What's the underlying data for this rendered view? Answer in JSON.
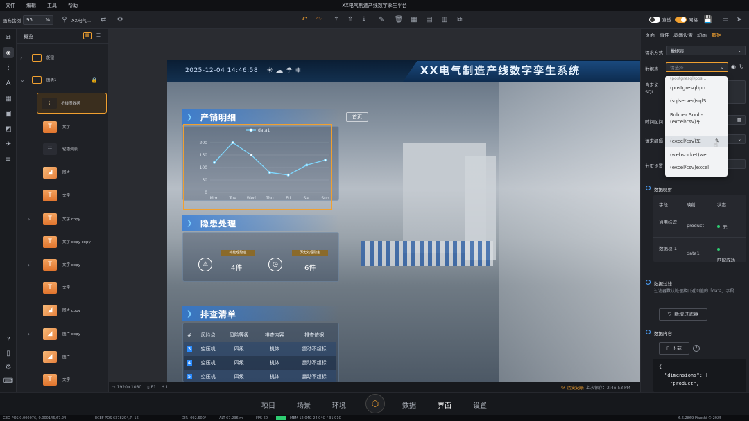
{
  "app": {
    "title": "XX电气制造产线数字孪生平台",
    "menu": [
      "文件",
      "编辑",
      "工具",
      "帮助"
    ]
  },
  "toolbar": {
    "zoom_label": "画布比例",
    "zoom_value": "95",
    "zoom_unit": "%",
    "project_name": "XX电气..."
  },
  "toolbar_right": {
    "toggle1": "穿透",
    "toggle2": "网格"
  },
  "left_panel": {
    "title": "概览",
    "items": [
      {
        "label": "旋钮",
        "type": "folder"
      },
      {
        "label": "图表1",
        "type": "folder"
      },
      {
        "label": "折线图数据",
        "type": "chart"
      },
      {
        "label": "文字",
        "type": "text"
      },
      {
        "label": "轮播列表",
        "type": "list"
      },
      {
        "label": "图片",
        "type": "image"
      },
      {
        "label": "文字",
        "type": "text"
      },
      {
        "label": "文字 copy",
        "type": "text"
      },
      {
        "label": "文字 copy copy",
        "type": "text"
      },
      {
        "label": "文字 copy",
        "type": "text"
      },
      {
        "label": "文字",
        "type": "text"
      },
      {
        "label": "图片 copy",
        "type": "image"
      },
      {
        "label": "图片 copy",
        "type": "image"
      },
      {
        "label": "图片",
        "type": "image"
      },
      {
        "label": "文字",
        "type": "text"
      }
    ]
  },
  "scene": {
    "datetime": "2025-12-04 14:46:58",
    "title": "XX电气制造产线数字孪生系统",
    "home_button": "首页",
    "section1_title": "产销明细",
    "section2_title": "隐患处理",
    "section3_title": "排查清单",
    "hazard": {
      "pending_label": "待处理隐患",
      "pending_value": "4件",
      "processed_label": "历史处理隐患",
      "processed_value": "6件"
    },
    "risk_table": {
      "headers": [
        "#",
        "风险点",
        "风险等级",
        "排查内容",
        "排查依据"
      ],
      "rows": [
        [
          "3",
          "空压机",
          "四级",
          "机体",
          "震动不超标"
        ],
        [
          "4",
          "空压机",
          "四级",
          "机体",
          "震动不超标"
        ],
        [
          "5",
          "空压机",
          "四级",
          "机体",
          "震动不超标"
        ]
      ]
    }
  },
  "chart_data": {
    "type": "line",
    "categories": [
      "Mon",
      "Tue",
      "Wed",
      "Thu",
      "Fri",
      "Sat",
      "Sun"
    ],
    "series": [
      {
        "name": "data1",
        "values": [
          120,
          200,
          150,
          80,
          70,
          110,
          130
        ]
      }
    ],
    "ylim": [
      0,
      200
    ],
    "yticks": [
      0,
      50,
      100,
      150,
      200
    ],
    "legend": "top",
    "color": "#7fd8ff"
  },
  "statusbar": {
    "resolution": "1920×1080",
    "page": "P1",
    "layer_count": "1",
    "history": "历史记录",
    "last_saved": "上次保存：2:46:53 PM"
  },
  "bottom_nav": [
    "项目",
    "场景",
    "环境",
    "数据",
    "界面",
    "设置"
  ],
  "right_panel": {
    "tabs": [
      "页面",
      "事件",
      "基础设置",
      "动画",
      "数据"
    ],
    "request_label": "请求方式",
    "request_value": "数据表",
    "datasource_label": "数据表",
    "datasource_placeholder": "请选择",
    "sql_label": "自定义\nSQL",
    "time_label": "时间区间",
    "interval_label": "请求间隔",
    "page_label": "分页设置",
    "mapping_title": "数据映射",
    "mapping_headers": [
      "字段",
      "映射",
      "状态"
    ],
    "mapping_rows": [
      {
        "field": "通用标识",
        "map": "product",
        "status": "无"
      },
      {
        "field": "数据项-1",
        "map": "data1",
        "status": "匹配成功"
      }
    ],
    "filter_title": "数据过滤",
    "filter_desc": "过滤器默认处理接口返回值的「data」字段",
    "filter_button": "新增过滤器",
    "content_title": "数据内容",
    "download_button": "下载",
    "code_lines": [
      "{",
      "\"dimensions\": [",
      "\"product\","
    ]
  },
  "dropdown_options": [
    "(postgresql)pos...",
    "(postgresql)po...",
    "(sqlserver)sqlS...",
    "Rubber Soul - (excel/csv)车",
    "(excel/csv)车",
    "(websocket)we...",
    "(excel/csv)excel"
  ],
  "footer": {
    "geo": "GEO POS 0.000076,-0.000146,67.24",
    "ecef": "ECEF POS 6378204,7,-16",
    "dir": "DIR -092.600°",
    "alt": "ALT 67.236 m",
    "fps": "FPS 60",
    "mem": "MEM 12.04G 24.04G / 31.91G",
    "version": "6.6.2869 Piaoshi © 2025"
  },
  "colors": {
    "accent": "#4da3ff",
    "selection": "#f0a030",
    "success": "#2ecc71"
  }
}
